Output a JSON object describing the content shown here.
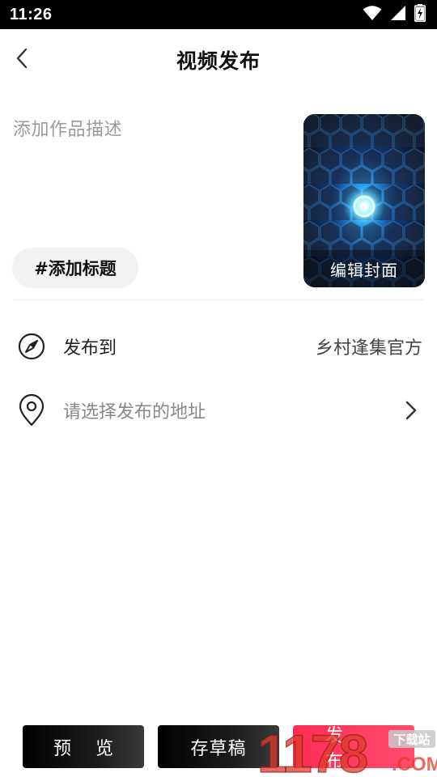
{
  "status_bar": {
    "time": "11:26",
    "icons": [
      "wifi-icon",
      "cellular-signal-icon",
      "battery-charging-icon"
    ]
  },
  "nav": {
    "back_icon": "chevron-left-icon",
    "title": "视频发布"
  },
  "description": {
    "placeholder": "添加作品描述"
  },
  "tag_button": {
    "label": "#添加标题"
  },
  "cover": {
    "label": "编辑封面",
    "image": "blue glowing hexagon pattern"
  },
  "rows": [
    {
      "icon": "compass-icon",
      "label": "发布到",
      "value": "乡村逢集官方"
    },
    {
      "icon": "location-pin-icon",
      "label": "请选择发布的地址",
      "arrow": "chevron-right-icon"
    }
  ],
  "bottom_bar": {
    "preview_label": "预览",
    "draft_label": "存草稿",
    "publish_label": "发布"
  },
  "watermark": {
    "text": "1178",
    "small_text": "下载站",
    "suffix": ".COM"
  },
  "colors": {
    "accent": "#ff2d55",
    "dark_button": "#000000",
    "muted_text": "#9a9a9a",
    "tag_bg": "#f2f2f2"
  }
}
